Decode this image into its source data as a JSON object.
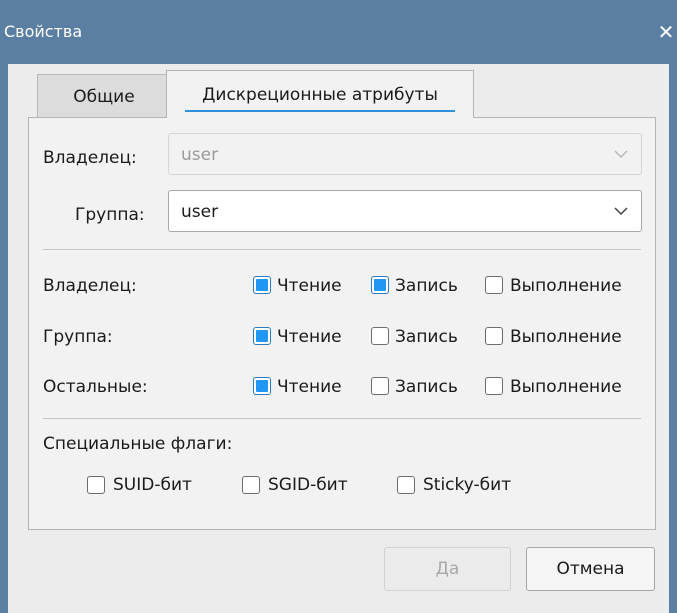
{
  "window": {
    "title": "Свойства",
    "close_glyph": "✕",
    "close_icon": "close-icon"
  },
  "tabs": [
    {
      "label": "Общие",
      "active": false
    },
    {
      "label": "Дискреционные атрибуты",
      "active": true
    }
  ],
  "owner": {
    "label": "Владелец:",
    "value": "user",
    "enabled": false
  },
  "group": {
    "label": "Группа:",
    "value": "user",
    "enabled": true
  },
  "permissions": {
    "rows": [
      {
        "label": "Владелец:",
        "read": {
          "label": "Чтение",
          "checked": true
        },
        "write": {
          "label": "Запись",
          "checked": true
        },
        "exec": {
          "label": "Выполнение",
          "checked": false
        }
      },
      {
        "label": "Группа:",
        "read": {
          "label": "Чтение",
          "checked": true
        },
        "write": {
          "label": "Запись",
          "checked": false
        },
        "exec": {
          "label": "Выполнение",
          "checked": false
        }
      },
      {
        "label": "Остальные:",
        "read": {
          "label": "Чтение",
          "checked": true
        },
        "write": {
          "label": "Запись",
          "checked": false
        },
        "exec": {
          "label": "Выполнение",
          "checked": false
        }
      }
    ]
  },
  "special": {
    "label": "Специальные флаги:",
    "suid": {
      "label": "SUID-бит",
      "checked": false
    },
    "sgid": {
      "label": "SGID-бит",
      "checked": false
    },
    "sticky": {
      "label": "Sticky-бит",
      "checked": false
    }
  },
  "buttons": {
    "ok": "Да",
    "cancel": "Отмена"
  },
  "colors": {
    "accent": "#2196f3",
    "titlebar": "#5b7fa3",
    "tab_underline": "#2f8fd8"
  }
}
